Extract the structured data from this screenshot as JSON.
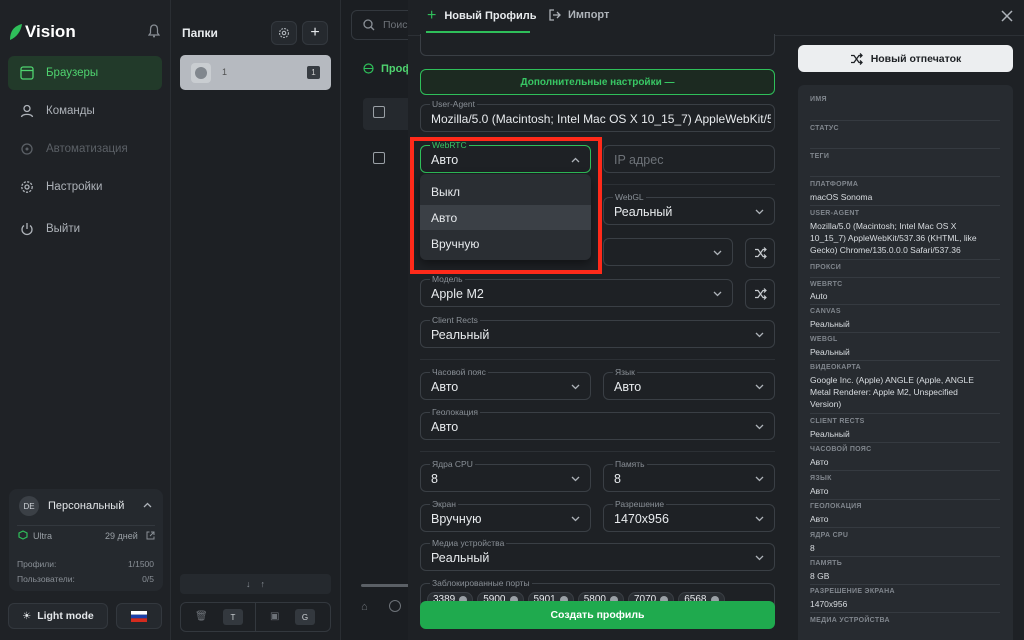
{
  "app": {
    "name": "Vision"
  },
  "sidebar": {
    "items": [
      {
        "label": "Браузеры"
      },
      {
        "label": "Команды"
      },
      {
        "label": "Автоматизация"
      },
      {
        "label": "Настройки"
      },
      {
        "label": "Выйти"
      }
    ],
    "account": {
      "initials": "DE",
      "name": "Персональный",
      "plan": "Ultra",
      "days": "29 дней",
      "profiles_label": "Профили:",
      "profiles_value": "1/1500",
      "users_label": "Пользователи:",
      "users_value": "0/5"
    },
    "light_mode_label": "Light mode"
  },
  "folders": {
    "title": "Папки",
    "item_name": "1",
    "item_count": "1",
    "bottom_t": "T",
    "bottom_g": "G"
  },
  "mid": {
    "search_placeholder": "Поиск",
    "tab_label": "Профили"
  },
  "panel": {
    "tab_new": "Новый Профиль",
    "tab_import": "Импорт",
    "advanced": "Дополнительные настройки —",
    "user_agent_label": "User-Agent",
    "user_agent_value": "Mozilla/5.0 (Macintosh; Intel Mac OS X 10_15_7) AppleWebKit/5",
    "webrtc_label": "WebRTC",
    "webrtc_value": "Авто",
    "ip_placeholder": "IP адрес",
    "webrtc_options": [
      "Выкл",
      "Авто",
      "Вручную"
    ],
    "webgl_label": "WebGL",
    "webgl_value": "Реальный",
    "model_label": "Модель",
    "model_value": "Apple M2",
    "client_rects_label": "Client Rects",
    "client_rects_value": "Реальный",
    "timezone_label": "Часовой пояс",
    "timezone_value": "Авто",
    "language_label": "Язык",
    "language_value": "Авто",
    "geo_label": "Геолокация",
    "geo_value": "Авто",
    "cpu_label": "Ядра CPU",
    "cpu_value": "8",
    "memory_label": "Память",
    "memory_value": "8",
    "screen_label": "Экран",
    "screen_value": "Вручную",
    "resolution_label": "Разрешение",
    "resolution_value": "1470x956",
    "media_label": "Медиа устройства",
    "media_value": "Реальный",
    "ports_label": "Заблокированные порты",
    "ports": [
      "3389",
      "5900",
      "5901",
      "5800",
      "7070",
      "6568"
    ],
    "create_button": "Создать профиль",
    "fingerprint_button": "Новый отпечаток"
  },
  "info": {
    "name_label": "ИМЯ",
    "status_label": "СТАТУС",
    "tags_label": "ТЕГИ",
    "platform_label": "ПЛАТФОРМА",
    "platform_value": "macOS Sonoma",
    "ua_label": "USER-AGENT",
    "ua_value": "Mozilla/5.0 (Macintosh; Intel Mac OS X 10_15_7) AppleWebKit/537.36 (KHTML, like Gecko) Chrome/135.0.0.0 Safari/537.36",
    "proxy_label": "ПРОКСИ",
    "webrtc_label": "WEBRTC",
    "webrtc_value": "Auto",
    "canvas_label": "CANVAS",
    "canvas_value": "Реальный",
    "webgl_label": "WEBGL",
    "webgl_value": "Реальный",
    "gpu_label": "ВИДЕОКАРТА",
    "gpu_value": "Google Inc. (Apple) ANGLE (Apple, ANGLE Metal Renderer: Apple M2, Unspecified Version)",
    "rects_label": "CLIENT RECTS",
    "rects_value": "Реальный",
    "tz_label": "ЧАСОВОЙ ПОЯС",
    "tz_value": "Авто",
    "lang_label": "ЯЗЫК",
    "lang_value": "Авто",
    "geo_label": "ГЕОЛОКАЦИЯ",
    "geo_value": "Авто",
    "cpu_label": "ЯДРА CPU",
    "cpu_value": "8",
    "mem_label": "ПАМЯТЬ",
    "mem_value": "8 GB",
    "res_label": "РАЗРЕШЕНИЕ ЭКРАНА",
    "res_value": "1470x956",
    "media_label": "МЕДИА УСТРОЙСТВА"
  },
  "colors": {
    "accent": "#1faa4e",
    "highlight": "#ff2a1a"
  }
}
